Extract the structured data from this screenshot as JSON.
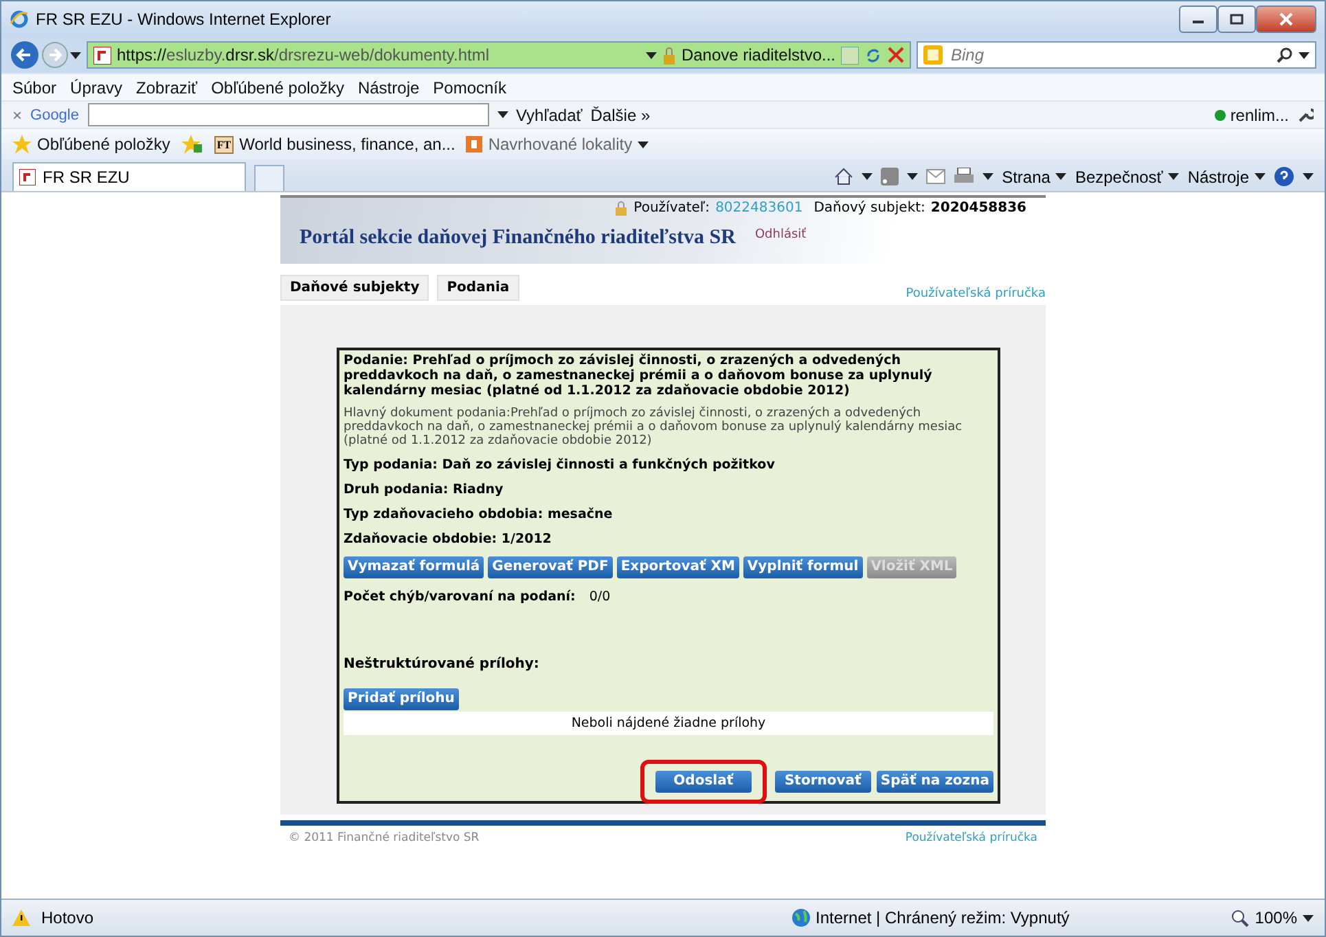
{
  "window": {
    "title": "FR SR EZU - Windows Internet Explorer"
  },
  "address_bar": {
    "url_parts": [
      {
        "text": "https://",
        "emphasis": true
      },
      {
        "text": "esluzby.",
        "emphasis": false
      },
      {
        "text": "drsr.sk",
        "emphasis": true
      },
      {
        "text": "/drsrezu-web/dokumenty.html",
        "emphasis": false
      }
    ],
    "site_identity": "Danove riaditelstvo...",
    "search": {
      "placeholder": "Bing"
    }
  },
  "menu": [
    "Súbor",
    "Úpravy",
    "Zobraziť",
    "Obľúbené položky",
    "Nástroje",
    "Pomocník"
  ],
  "google_bar": {
    "close": "×",
    "logo": "Google",
    "search_button": "Vyhľadať",
    "more": "Ďalšie »",
    "account": "renlim..."
  },
  "favorites_bar": {
    "favorites": "Obľúbené položky",
    "links": [
      {
        "badge": "FT",
        "label": "World business, finance, an...",
        "dropdown": false
      },
      {
        "label": "Navrhované lokality",
        "dropdown": true
      }
    ]
  },
  "tab": {
    "title": "FR SR EZU"
  },
  "command_bar": [
    "Strana",
    "Bezpečnosť",
    "Nástroje"
  ],
  "page": {
    "header": {
      "title": "Portál sekcie daňovej Finančného riaditeľstva SR",
      "user_label": "Používateľ:",
      "user_id": "8022483601",
      "subject_label": "Daňový subjekt:",
      "subject_id": "2020458836",
      "logout": "Odhlásiť"
    },
    "nav_links": [
      "Daňové subjekty",
      "Podania"
    ],
    "help_link": "Používateľská príručka",
    "form": {
      "heading": "Podanie: Prehľad o príjmoch zo závislej činnosti, o zrazených a odvedených preddavkoch na daň, o zamestnaneckej prémii a o daňovom bonuse za uplynulý kalendárny mesiac (platné od 1.1.2012 za zdaňovacie obdobie 2012)",
      "main_document": "Hlavný dokument podania:Prehľad o príjmoch zo závislej činnosti, o zrazených a odvedených preddavkoch na daň, o zamestnaneckej prémii a o daňovom bonuse za uplynulý kalendárny mesiac (platné od 1.1.2012 za zdaňovacie obdobie 2012)",
      "fields": [
        "Typ podania: Daň zo závislej činnosti a funkčných požitkov",
        "Druh podania: Riadny",
        "Typ zdaňovacieho obdobia: mesačne",
        "Zdaňovacie obdobie: 1/2012"
      ],
      "buttons": [
        {
          "label": "Vymazať formulá",
          "disabled": false
        },
        {
          "label": "Generovať PDF",
          "disabled": false
        },
        {
          "label": "Exportovať XM",
          "disabled": false
        },
        {
          "label": "Vyplniť formul",
          "disabled": false
        },
        {
          "label": "Vložiť XML",
          "disabled": true
        }
      ],
      "error_count": {
        "label": "Počet chýb/varovaní na podaní:",
        "value": "0/0"
      },
      "attachments": {
        "label": "Neštruktúrované prílohy:",
        "add_button": "Pridať prílohu",
        "empty_message": "Neboli nájdené žiadne prílohy"
      },
      "actions": [
        {
          "label": "Odoslať",
          "highlighted": true
        },
        {
          "label": "Stornovať",
          "highlighted": false
        },
        {
          "label": "Späť na zozna",
          "highlighted": false
        }
      ]
    },
    "footer": {
      "copyright": "© 2011 Finančné riaditeľstvo SR",
      "help_link": "Používateľská príručka"
    }
  },
  "status_bar": {
    "status": "Hotovo",
    "zone": "Internet | Chránený režim: Vypnutý",
    "zoom": "100%"
  }
}
